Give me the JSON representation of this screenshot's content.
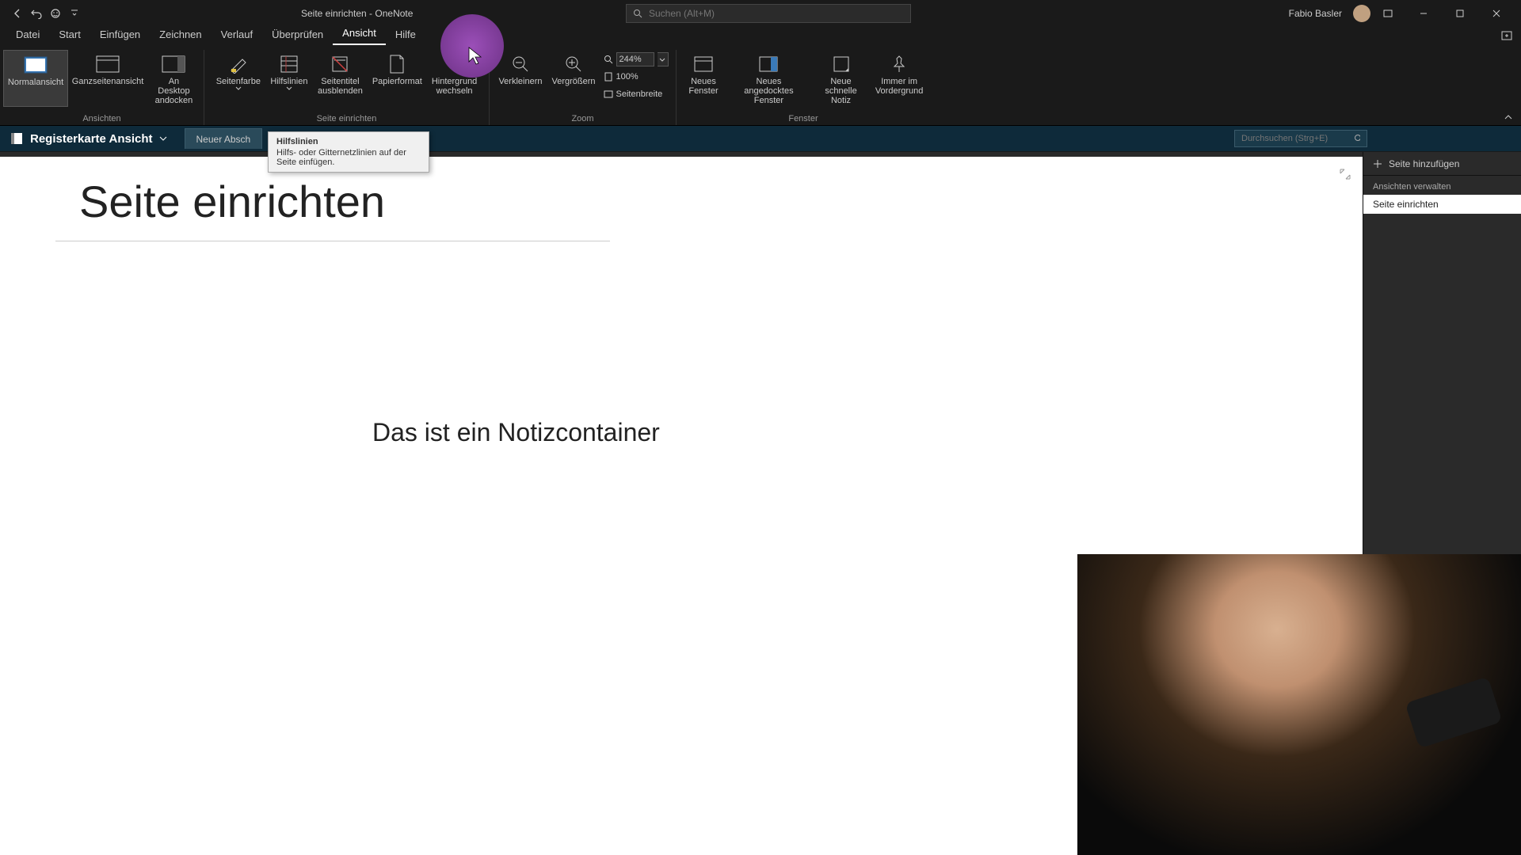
{
  "titlebar": {
    "title": "Seite einrichten  -  OneNote",
    "search_placeholder": "Suchen (Alt+M)",
    "user_name": "Fabio Basler"
  },
  "menus": {
    "datei": "Datei",
    "start": "Start",
    "einfuegen": "Einfügen",
    "zeichnen": "Zeichnen",
    "verlauf": "Verlauf",
    "ueberpruefen": "Überprüfen",
    "ansicht": "Ansicht",
    "hilfe": "Hilfe"
  },
  "ribbon": {
    "ansichten": {
      "group": "Ansichten",
      "normal": "Normalansicht",
      "ganzseiten": "Ganzseitenansicht",
      "andocken": "An Desktop\nandocken"
    },
    "seite": {
      "group": "Seite einrichten",
      "seitenfarbe": "Seitenfarbe",
      "hilfslinien": "Hilfslinien",
      "seitentitel": "Seitentitel\nausblenden",
      "papier": "Papierformat",
      "hintergrund": "Hintergrund\nwechseln"
    },
    "zoom": {
      "group": "Zoom",
      "verkleinern": "Verkleinern",
      "vergroessern": "Vergrößern",
      "value": "244%",
      "hundred": "100%",
      "seitenbreite": "Seitenbreite"
    },
    "fenster": {
      "group": "Fenster",
      "neues": "Neues\nFenster",
      "angedockt": "Neues angedocktes\nFenster",
      "schnelle": "Neue\nschnelle Notiz",
      "immer": "Immer im\nVordergrund"
    }
  },
  "tooltip": {
    "title": "Hilfslinien",
    "body": "Hilfs- oder Gitternetzlinien auf der Seite einfügen."
  },
  "nav": {
    "notebook": "Registerkarte Ansicht",
    "section": "Neuer Absch",
    "search_placeholder": "Durchsuchen (Strg+E)"
  },
  "page": {
    "title": "Seite einrichten",
    "note": "Das ist ein Notizcontainer"
  },
  "panel": {
    "add_page": "Seite hinzufügen",
    "manage": "Ansichten verwalten",
    "active_page": "Seite einrichten"
  }
}
